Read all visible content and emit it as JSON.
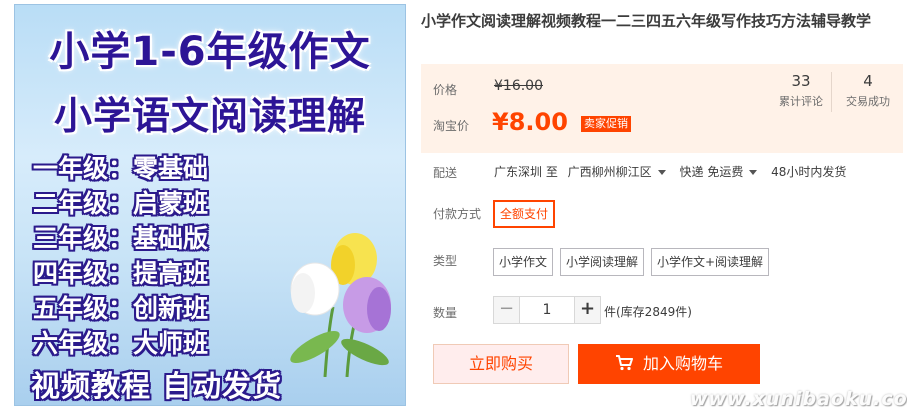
{
  "product_image": {
    "title_line_1": "小学1-6年级作文",
    "title_line_2": "小学语文阅读理解",
    "grades": [
      "一年级：零基础",
      "二年级：启蒙班",
      "三年级：基础版",
      "四年级：提高班",
      "五年级：创新班",
      "六年级：大师班"
    ],
    "footer": "视频教程   自动发货"
  },
  "product": {
    "title": "小学作文阅读理解视频教程一二三四五六年级写作技巧方法辅导教学"
  },
  "price": {
    "original_label": "价格",
    "original_value": "¥16.00",
    "promo_label": "淘宝价",
    "promo_value": "¥8.00",
    "promo_badge": "卖家促销"
  },
  "stats": {
    "reviews_count": "33",
    "reviews_label": "累计评论",
    "sales_count": "4",
    "sales_label": "交易成功"
  },
  "delivery": {
    "label": "配送",
    "from": "广东深圳 至",
    "to": "广西柳州柳江区",
    "shipping": "快递 免运费",
    "dispatch": "48小时内发货"
  },
  "payment": {
    "label": "付款方式",
    "option": "全额支付"
  },
  "type": {
    "label": "类型",
    "options": [
      "小学作文",
      "小学阅读理解",
      "小学作文+阅读理解"
    ]
  },
  "quantity": {
    "label": "数量",
    "minus": "−",
    "value": "1",
    "plus": "+",
    "stock": "件(库存2849件)"
  },
  "actions": {
    "buy_now": "立即购买",
    "add_to_cart": "加入购物车"
  },
  "watermark": "www.xunibaoku.com",
  "icons": {
    "cart": "shopping-cart-icon",
    "caret": "chevron-down-icon"
  },
  "colors": {
    "accent": "#ff4400",
    "price_box_bg": "#fff2e8",
    "buy_now_bg": "#ffeded",
    "image_title": "#2d1596"
  }
}
